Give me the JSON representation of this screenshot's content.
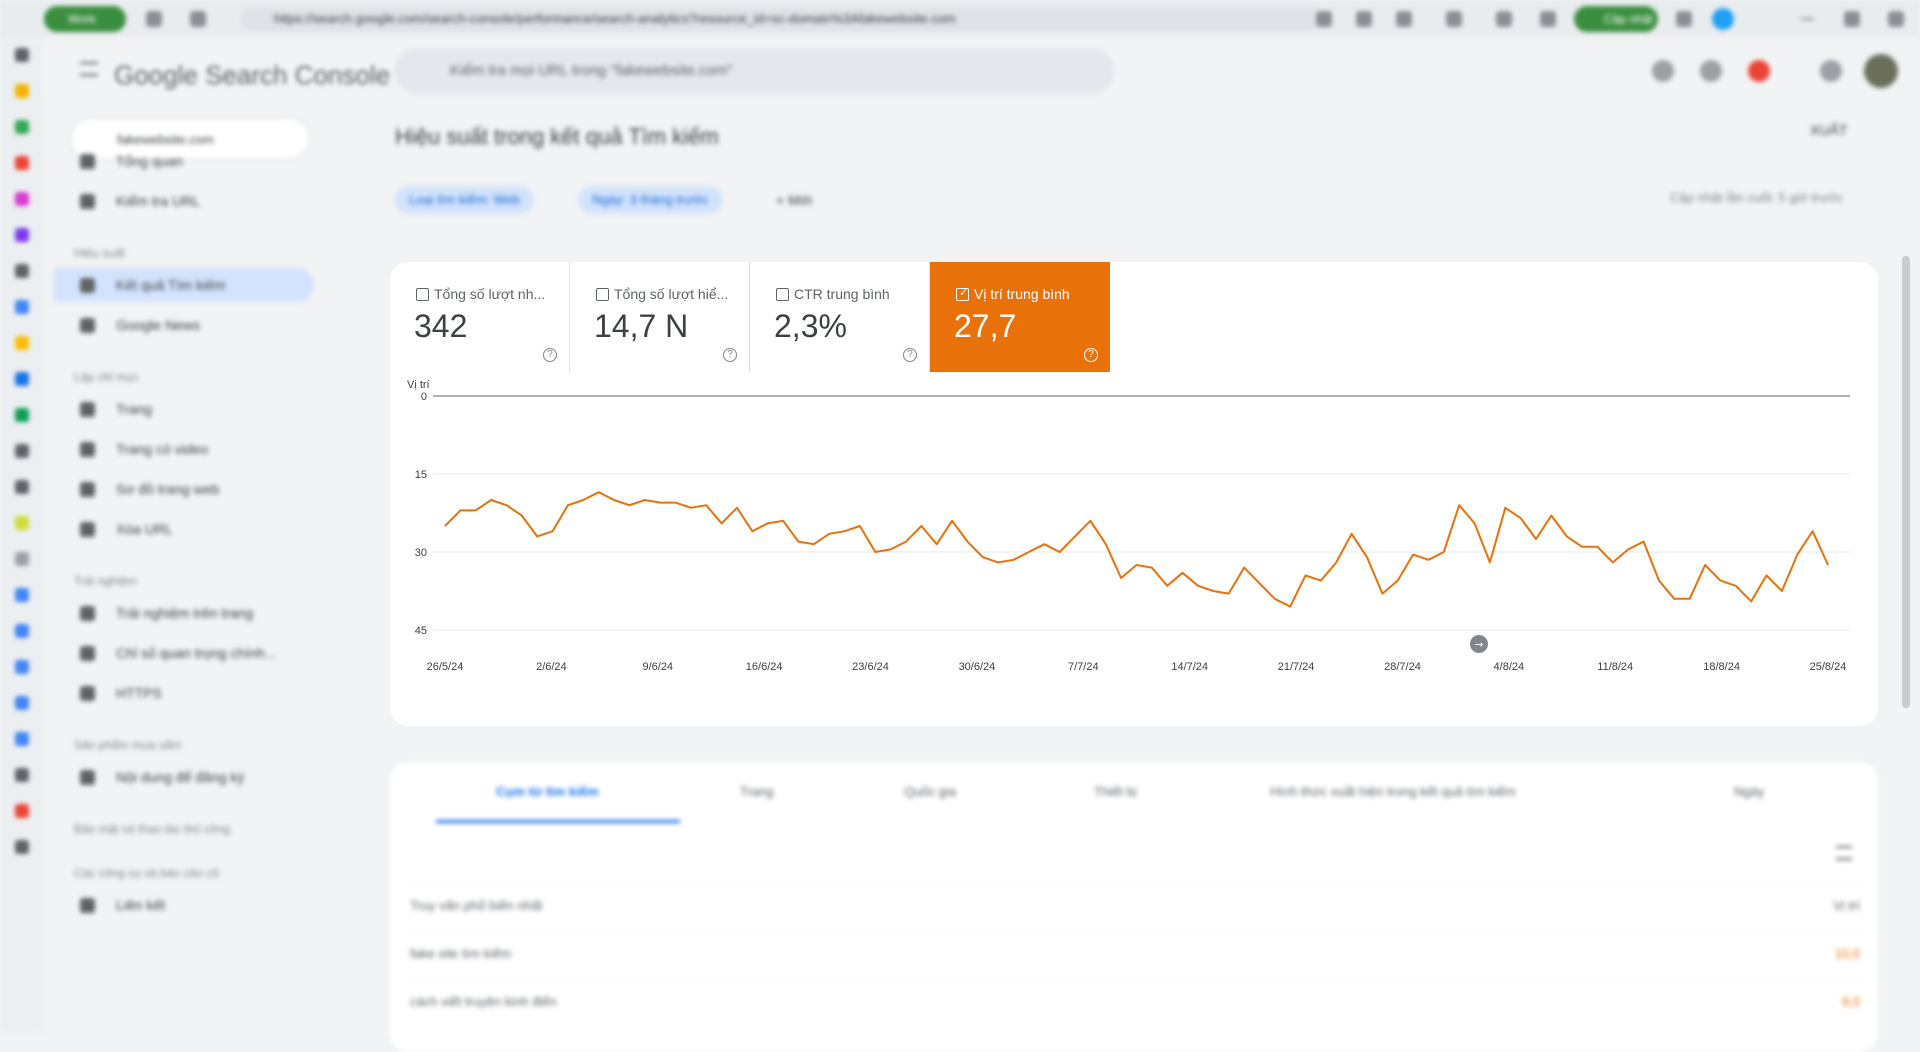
{
  "browser": {
    "url": "https://search.google.com/search-console/performance/search-analytics?resource_id=sc-domain%3Afakewebsite.com",
    "profile_label": "Work",
    "update_label": "Cập nhật"
  },
  "header": {
    "logo": "Google Search Console",
    "search_placeholder": "Kiểm tra mọi URL trong \"fakewebsite.com\""
  },
  "sidebar": {
    "property": "fakewebsite.com",
    "items": [
      {
        "label": "Tổng quan"
      },
      {
        "label": "Kiểm tra URL"
      },
      {
        "section": "Hiệu suất"
      },
      {
        "label": "Kết quả Tìm kiếm",
        "selected": true
      },
      {
        "label": "Google News"
      },
      {
        "section": "Lập chỉ mục"
      },
      {
        "label": "Trang"
      },
      {
        "label": "Trang có video"
      },
      {
        "label": "Sơ đồ trang web"
      },
      {
        "label": "Xóa URL"
      },
      {
        "section": "Trải nghiệm"
      },
      {
        "label": "Trải nghiệm trên trang"
      },
      {
        "label": "Chỉ số quan trọng chính..."
      },
      {
        "label": "HTTPS"
      },
      {
        "section": "Sản phẩm mua sắm"
      },
      {
        "label": "Nội dung để đăng ký"
      },
      {
        "section": "Bảo mật và thao tác thủ công"
      },
      {
        "section": "Các công cụ và báo cáo cũ"
      },
      {
        "label": "Liên kết"
      }
    ]
  },
  "main": {
    "title": "Hiệu suất trong kết quả Tìm kiếm",
    "export_label": "XUẤT",
    "filters": [
      "Loại tìm kiếm: Web",
      "Ngày: 3 tháng trước"
    ],
    "add_filter_label": "Mới",
    "last_updated": "Cập nhật lần cuối: 5 giờ trước"
  },
  "metrics": [
    {
      "label": "Tổng số lượt nhấp",
      "label_display": "Tổng số lượt nh...",
      "value": "342",
      "checked": false
    },
    {
      "label": "Tổng số lượt hiển thị",
      "label_display": "Tổng số lượt hiể...",
      "value": "14,7 N",
      "checked": false
    },
    {
      "label": "CTR trung bình",
      "label_display": "CTR trung bình",
      "value": "2,3%",
      "checked": false
    },
    {
      "label": "Vị trí trung bình",
      "label_display": "Vị trí trung bình",
      "value": "27,7",
      "checked": true
    }
  ],
  "colors": {
    "position_series": "#e8710a",
    "accent": "#1a73e8"
  },
  "chart_data": {
    "type": "line",
    "ylabel": "Vị trí",
    "y_inverted": true,
    "ylim": [
      0,
      45
    ],
    "yticks": [
      0,
      15,
      30,
      45
    ],
    "x_start": "26/5/24",
    "x_end": "25/8/24",
    "xtick_labels": [
      "26/5/24",
      "2/6/24",
      "9/6/24",
      "16/6/24",
      "23/6/24",
      "30/6/24",
      "7/7/24",
      "14/7/24",
      "21/7/24",
      "28/7/24",
      "4/8/24",
      "11/8/24",
      "18/8/24",
      "25/8/24"
    ],
    "series": [
      {
        "values": [
          25,
          22,
          22,
          20,
          21,
          23,
          27,
          26,
          21,
          20,
          18.5,
          20,
          21,
          20,
          20.5,
          20.5,
          21.5,
          21,
          24.5,
          21.5,
          26,
          24.5,
          24,
          28,
          28.5,
          26.5,
          26,
          25,
          30,
          29.5,
          28,
          25,
          28.5,
          24,
          28,
          31,
          32,
          31.5,
          30,
          28.5,
          30,
          27,
          24,
          28.5,
          35,
          32.5,
          33,
          36.5,
          34,
          36.5,
          37.5,
          38,
          33,
          36,
          39,
          40.5,
          34.5,
          35.5,
          32,
          26.5,
          31,
          38,
          35.5,
          30.5,
          31.5,
          30,
          21,
          24.5,
          32,
          21.5,
          23.5,
          27.5,
          23,
          27,
          29,
          29,
          32,
          29.5,
          28,
          35.5,
          39,
          39,
          32.5,
          35.5,
          36.5,
          39.5,
          34.5,
          37.5,
          30.5,
          26,
          32.5
        ]
      }
    ]
  },
  "table": {
    "tabs": [
      "Cụm từ tìm kiếm",
      "Trang",
      "Quốc gia",
      "Thiết bị",
      "Hình thức xuất hiện trong kết quả tìm kiếm",
      "Ngày"
    ],
    "rows": [
      {
        "label": "Truy vấn phổ biến nhất",
        "value": "Vị trí"
      },
      {
        "label": "fake site tìm kiếm",
        "value": "10,0"
      },
      {
        "label": "cách viết truyện kinh điển",
        "value": "9,0"
      }
    ]
  }
}
